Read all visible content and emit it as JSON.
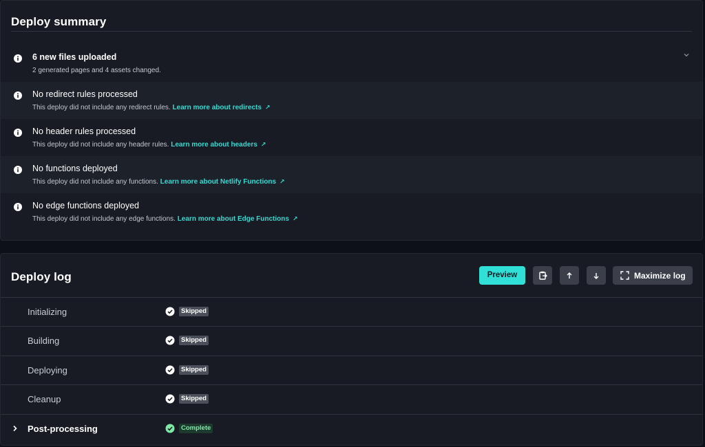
{
  "summary": {
    "title": "Deploy summary",
    "rows": [
      {
        "heading": "6 new files uploaded",
        "desc": "2 generated pages and 4 assets changed.",
        "link": ""
      },
      {
        "heading": "No redirect rules processed",
        "desc": "This deploy did not include any redirect rules.",
        "link": "Learn more about redirects"
      },
      {
        "heading": "No header rules processed",
        "desc": "This deploy did not include any header rules.",
        "link": "Learn more about headers"
      },
      {
        "heading": "No functions deployed",
        "desc": "This deploy did not include any functions.",
        "link": "Learn more about Netlify Functions"
      },
      {
        "heading": "No edge functions deployed",
        "desc": "This deploy did not include any edge functions.",
        "link": "Learn more about Edge Functions"
      }
    ]
  },
  "log": {
    "title": "Deploy log",
    "preview_label": "Preview",
    "maximize_label": "Maximize log",
    "steps": [
      {
        "name": "Initializing",
        "status": "Skipped"
      },
      {
        "name": "Building",
        "status": "Skipped"
      },
      {
        "name": "Deploying",
        "status": "Skipped"
      },
      {
        "name": "Cleanup",
        "status": "Skipped"
      },
      {
        "name": "Post-processing",
        "status": "Complete"
      }
    ]
  },
  "icons": {
    "info": "info-icon",
    "external": "external-link-icon",
    "expand": "chevron-down-icon",
    "copy": "clipboard-icon",
    "scroll_up": "arrow-up-icon",
    "scroll_down": "arrow-down-icon",
    "maximize": "maximize-icon",
    "check": "check-circle-icon",
    "caret": "chevron-right-icon"
  },
  "colors": {
    "accent": "#30e0d7",
    "link": "#38d9d1",
    "complete": "#7ee8a6",
    "skipped_badge": "#4a4f59"
  }
}
